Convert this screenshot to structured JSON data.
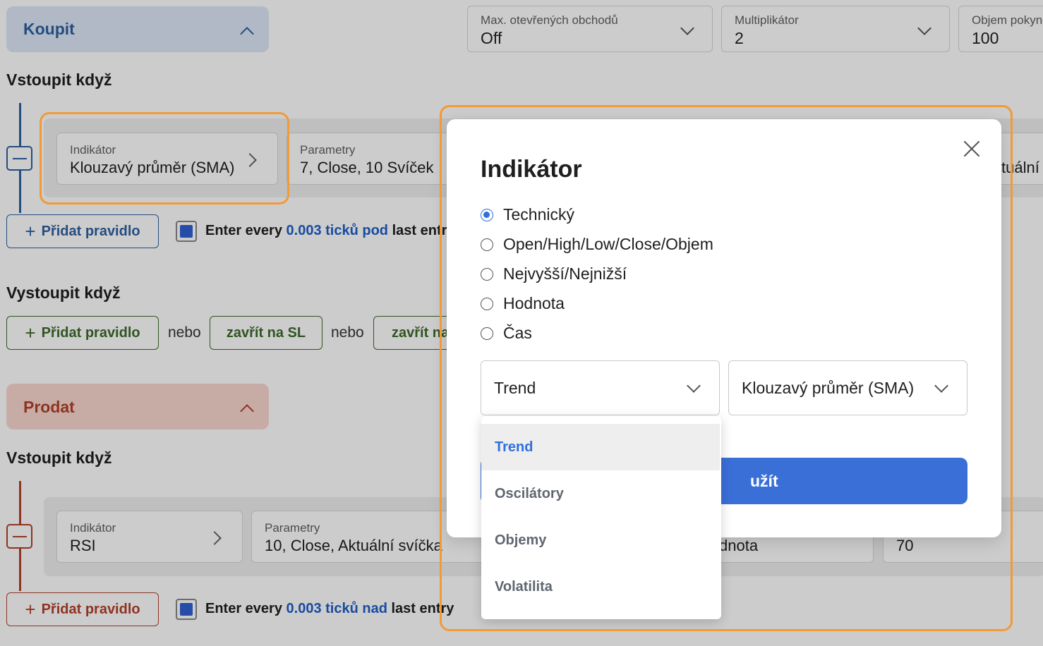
{
  "buy": {
    "header_label": "Koupit",
    "enter_heading": "Vstoupit když",
    "rule": {
      "indicator_label": "Indikátor",
      "indicator_value": "Klouzavý průměr (SMA)",
      "params_label": "Parametry",
      "params_value": "7, Close, 10 Svíček",
      "right_fragment": "tuální"
    },
    "add_rule_label": "Přidat pravidlo",
    "enter_every": {
      "prefix": "Enter every",
      "value": "0.003 ticků pod",
      "suffix": "last entry"
    },
    "exit_heading": "Vystoupit když",
    "exit_add_rule_label": "Přidat pravidlo",
    "or_label": "nebo",
    "close_sl_label": "zavřít na SL",
    "close_tp_label": "zavřít na"
  },
  "top_settings": {
    "max_open": {
      "label": "Max. otevřených obchodů",
      "value": "Off"
    },
    "multiplier": {
      "label": "Multiplikátor",
      "value": "2"
    },
    "order_volume": {
      "label": "Objem pokyn",
      "value": "100"
    }
  },
  "sell": {
    "header_label": "Prodat",
    "enter_heading": "Vstoupit když",
    "rule": {
      "indicator_label": "Indikátor",
      "indicator_value": "RSI",
      "params_label": "Parametry",
      "params_value": "10, Close, Aktuální svíčka",
      "third_value": "dnota",
      "fourth_value": "70"
    },
    "add_rule_label": "Přidat pravidlo",
    "enter_every": {
      "prefix": "Enter every",
      "value": "0.003 ticků nad",
      "suffix": "last entry"
    }
  },
  "modal": {
    "title": "Indikátor",
    "options": [
      "Technický",
      "Open/High/Low/Close/Objem",
      "Nejvyšší/Nejnižší",
      "Hodnota",
      "Čas"
    ],
    "selected_option_index": 0,
    "category_select": "Trend",
    "indicator_select": "Klouzavý průměr (SMA)",
    "apply_button_fragment": "užít",
    "dropdown_options": [
      "Trend",
      "Oscilátory",
      "Objemy",
      "Volatilita"
    ],
    "dropdown_selected_index": 0
  },
  "colors": {
    "buy_accent": "#2f5fa0",
    "sell_accent": "#b3402a",
    "exit_accent": "#3d6b2a",
    "primary_blue": "#3b6fd8",
    "highlight_orange": "#f29a38",
    "link_blue": "#1f5fc9"
  }
}
